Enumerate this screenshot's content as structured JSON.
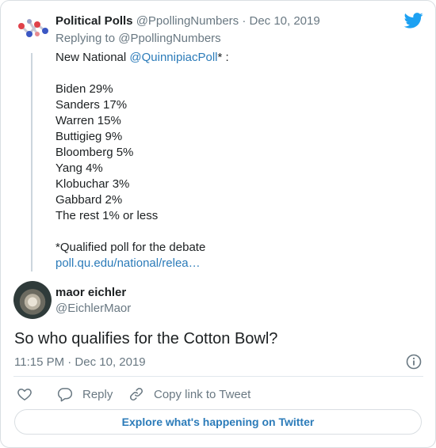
{
  "quoted": {
    "name": "Political Polls",
    "handle_date": "@PpollingNumbers · Dec 10, 2019",
    "replying_to": "Replying to @PpollingNumbers",
    "line_prefix": "New National ",
    "mention": "@QuinnipiacPoll",
    "line_suffix": "* :",
    "results": [
      "Biden 29%",
      "Sanders 17%",
      "Warren 15%",
      "Buttigieg 9%",
      "Bloomberg 5%",
      "Yang 4%",
      "Klobuchar 3%",
      "Gabbard 2%",
      "The rest 1% or less"
    ],
    "footnote": "*Qualified poll for the debate",
    "link": "poll.qu.edu/national/relea…"
  },
  "tweet": {
    "name": "maor eichler",
    "handle": "@EichlerMaor",
    "text": "So who qualifies for the Cotton Bowl?",
    "timestamp": "11:15 PM · Dec 10, 2019"
  },
  "actions": {
    "reply": "Reply",
    "copy_link": "Copy link to Tweet"
  },
  "explore": "Explore what's happening on Twitter",
  "colors": {
    "twitter_blue": "#1da1f2",
    "link": "#2b7bb9",
    "muted": "#697882"
  },
  "icons": [
    "political-polls-logo-icon",
    "twitter-bird-icon",
    "info-icon",
    "heart-icon",
    "reply-icon",
    "copy-link-icon"
  ]
}
